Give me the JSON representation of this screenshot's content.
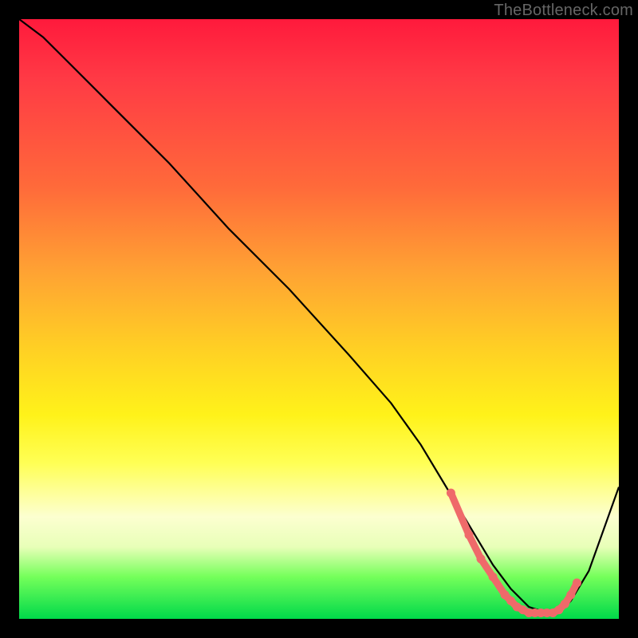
{
  "watermark": "TheBottleneck.com",
  "chart_data": {
    "type": "line",
    "title": "",
    "xlabel": "",
    "ylabel": "",
    "xlim": [
      0,
      100
    ],
    "ylim": [
      0,
      100
    ],
    "grid": false,
    "legend": false,
    "series": [
      {
        "name": "bottleneck-curve",
        "color": "#000000",
        "x": [
          0,
          4,
          8,
          15,
          25,
          35,
          45,
          55,
          62,
          67,
          70,
          73,
          76,
          79,
          82,
          85,
          88,
          90,
          92,
          95,
          100
        ],
        "y": [
          100,
          97,
          93,
          86,
          76,
          65,
          55,
          44,
          36,
          29,
          24,
          19,
          14,
          9,
          5,
          2,
          1,
          1,
          3,
          8,
          22
        ]
      }
    ],
    "markers": [
      {
        "name": "highlight-dots",
        "color": "#ef6a6a",
        "x": [
          72,
          75,
          77,
          79,
          81,
          82,
          83,
          84,
          85,
          86,
          87,
          88,
          89,
          90,
          91,
          92,
          93
        ],
        "y": [
          21,
          14,
          10,
          7,
          4,
          3,
          2,
          1.5,
          1,
          1,
          1,
          1,
          1,
          1.5,
          2.5,
          4,
          6
        ]
      }
    ]
  }
}
